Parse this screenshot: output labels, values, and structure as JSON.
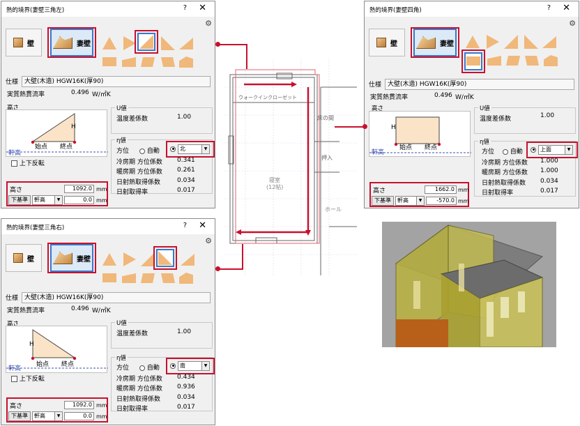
{
  "dialog_left": {
    "title": "熱的境界(妻壁三角左)",
    "help": "?",
    "close": "✕",
    "tab_wall": "壁",
    "tab_gable": "妻壁",
    "spec_label": "仕様",
    "spec_value": "大壁(木造) HGW16K(厚90)",
    "heat_label": "実質熱貫流率",
    "heat_value": "0.496",
    "heat_unit": "W/㎡K",
    "height_group": "高さ",
    "diagram_H": "H",
    "diagram_start": "始点",
    "diagram_end": "終点",
    "eaves": "軒高",
    "flip_label": "上下反転",
    "u_group": "U値",
    "temp_label": "温度差係数",
    "temp_value": "1.00",
    "eta_group": "η値",
    "dir_label": "方位",
    "auto_label": "自動",
    "dir_value": "北",
    "cool_label": "冷房期 方位係数",
    "cool_value": "0.341",
    "heat_period_label": "暖房期 方位係数",
    "heat_period_value": "0.261",
    "solar_gain_label": "日射熱取得係数",
    "solar_gain_value": "0.034",
    "solar_rate_label": "日射取得率",
    "solar_rate_value": "0.017",
    "height_label": "高さ",
    "height_value": "1092.0",
    "base_button": "下基準",
    "base_select": "軒高",
    "offset_value": "0.0",
    "mm": "mm"
  },
  "dialog_left2": {
    "title": "熱的境界(妻壁三角右)",
    "help": "?",
    "close": "✕",
    "tab_wall": "壁",
    "tab_gable": "妻壁",
    "spec_label": "仕様",
    "spec_value": "大壁(木造) HGW16K(厚90)",
    "heat_label": "実質熱貫流率",
    "heat_value": "0.496",
    "heat_unit": "W/㎡K",
    "height_group": "高さ",
    "diagram_H": "H",
    "diagram_start": "始点",
    "diagram_end": "終点",
    "eaves": "軒高",
    "flip_label": "上下反転",
    "u_group": "U値",
    "temp_label": "温度差係数",
    "temp_value": "1.00",
    "eta_group": "η値",
    "dir_label": "方位",
    "auto_label": "自動",
    "dir_value": "南",
    "cool_label": "冷房期 方位係数",
    "cool_value": "0.434",
    "heat_period_label": "暖房期 方位係数",
    "heat_period_value": "0.936",
    "solar_gain_label": "日射熱取得係数",
    "solar_gain_value": "0.034",
    "solar_rate_label": "日射取得率",
    "solar_rate_value": "0.017",
    "height_label": "高さ",
    "height_value": "1092.0",
    "base_button": "下基準",
    "base_select": "軒高",
    "offset_value": "0.0",
    "mm": "mm"
  },
  "dialog_right": {
    "title": "熱的境界(妻壁四角)",
    "help": "?",
    "close": "✕",
    "tab_wall": "壁",
    "tab_gable": "妻壁",
    "spec_label": "仕様",
    "spec_value": "大壁(木造) HGW16K(厚90)",
    "heat_label": "実質熱貫流率",
    "heat_value": "0.496",
    "heat_unit": "W/㎡K",
    "height_group": "高さ",
    "diagram_H": "H",
    "diagram_start": "始点",
    "diagram_end": "終点",
    "eaves": "軒高",
    "u_group": "U値",
    "temp_label": "温度差係数",
    "temp_value": "1.00",
    "eta_group": "η値",
    "dir_label": "方位",
    "auto_label": "自動",
    "dir_value": "上面",
    "cool_label": "冷房期 方位係数",
    "cool_value": "1.000",
    "heat_period_label": "暖房期 方位係数",
    "heat_period_value": "1.000",
    "solar_gain_label": "日射熱取得係数",
    "solar_gain_value": "0.034",
    "solar_rate_label": "日射取得率",
    "solar_rate_value": "0.017",
    "height_label": "高さ",
    "height_value": "1662.0",
    "base_button": "下基準",
    "base_select": "軒高",
    "offset_value": "-570.0",
    "mm": "mm"
  },
  "plan": {
    "closet": "ウォークインクローゼット",
    "tokonoma": "床の間",
    "oshiire": "押入",
    "bedroom": "寝室",
    "bedroom_size": "(12帖)",
    "hall": "ホール"
  },
  "colors": {
    "accent_red": "#c8102e",
    "select_blue": "#3a78c8",
    "shape_fill": "#f0b87a"
  }
}
